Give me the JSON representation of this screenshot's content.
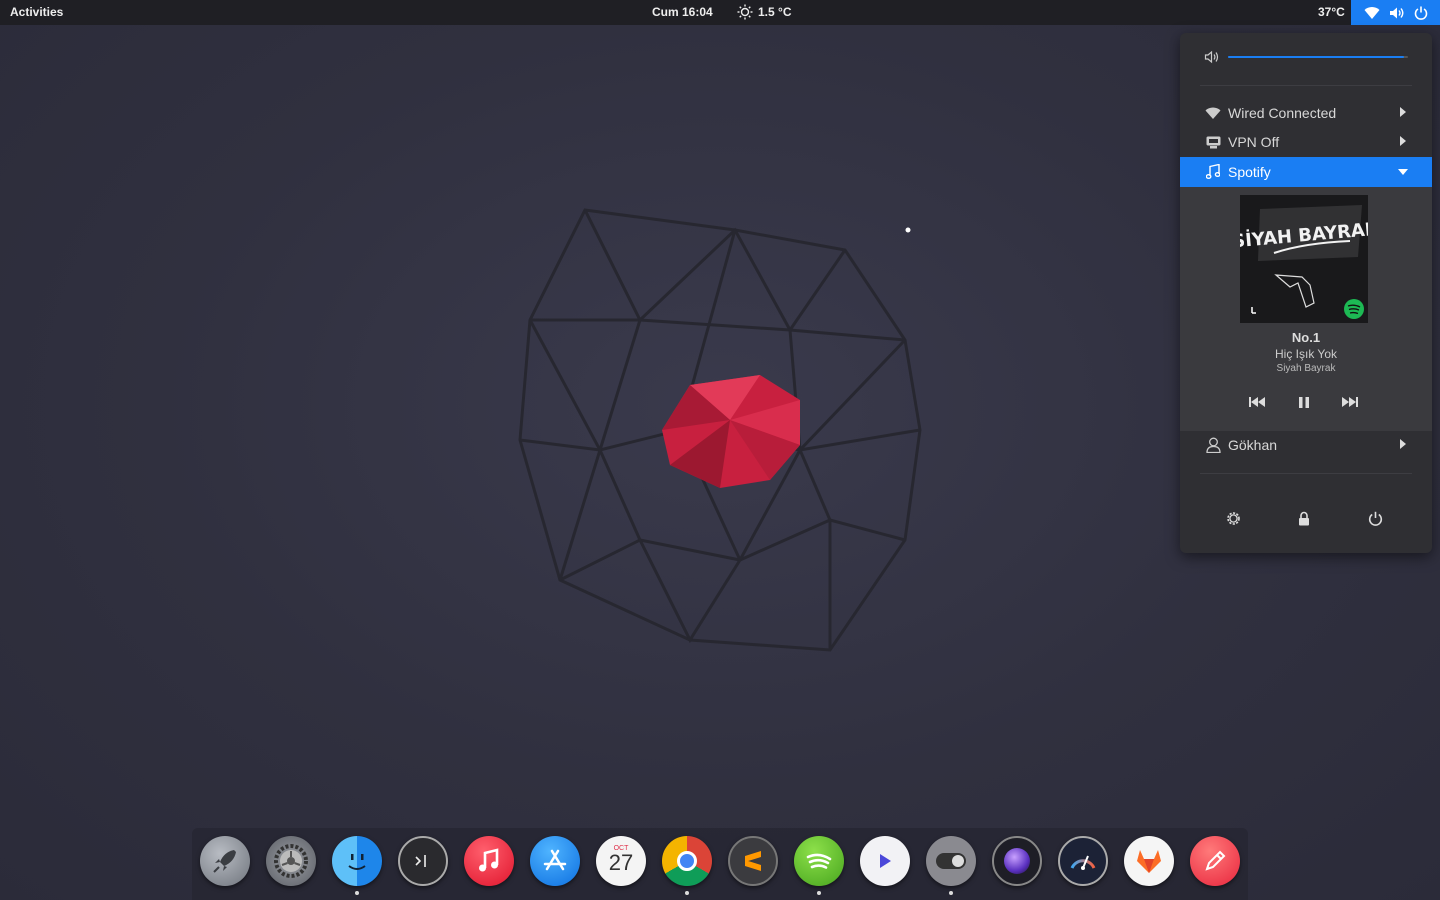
{
  "topbar": {
    "activities": "Activities",
    "clock": "Cum 16:04",
    "weather_temp": "1.5 °C",
    "system_temp": "37°C",
    "tray_icons": [
      "wifi-icon",
      "volume-icon",
      "power-icon"
    ]
  },
  "menu": {
    "volume_level": 0.98,
    "items": [
      {
        "label": "Wired Connected",
        "icon": "wired-network-icon"
      },
      {
        "label": "VPN Off",
        "icon": "vpn-icon"
      },
      {
        "label": "Spotify",
        "icon": "music-note-icon"
      },
      {
        "label": "Gökhan",
        "icon": "user-icon"
      }
    ],
    "player": {
      "album_art_text": "SİYAH BAYRAK",
      "title": "No.1",
      "album": "Hiç Işık Yok",
      "artist": "Siyah Bayrak",
      "controls": [
        "previous-icon",
        "pause-icon",
        "next-icon"
      ]
    },
    "bottom_buttons": [
      "settings-icon",
      "lock-icon",
      "power-icon"
    ]
  },
  "dock": {
    "apps": [
      {
        "name": "launchpad",
        "running": false
      },
      {
        "name": "system-preferences",
        "running": false
      },
      {
        "name": "finder",
        "running": true
      },
      {
        "name": "terminal",
        "running": false
      },
      {
        "name": "music",
        "running": false
      },
      {
        "name": "app-store",
        "running": false
      },
      {
        "name": "calendar",
        "running": false,
        "month": "OCT",
        "day": "27"
      },
      {
        "name": "chrome",
        "running": true
      },
      {
        "name": "sublime-text",
        "running": false
      },
      {
        "name": "spotify",
        "running": true
      },
      {
        "name": "video-player",
        "running": false
      },
      {
        "name": "tweaks",
        "running": true
      },
      {
        "name": "screenshot",
        "running": false
      },
      {
        "name": "system-monitor",
        "running": false
      },
      {
        "name": "gitlab",
        "running": false
      },
      {
        "name": "text-editor",
        "running": false
      }
    ]
  },
  "colors": {
    "accent": "#1a7ef3",
    "topbar": "#1f1f24",
    "popup": "#2f2f33",
    "desktop": "#30303f"
  }
}
